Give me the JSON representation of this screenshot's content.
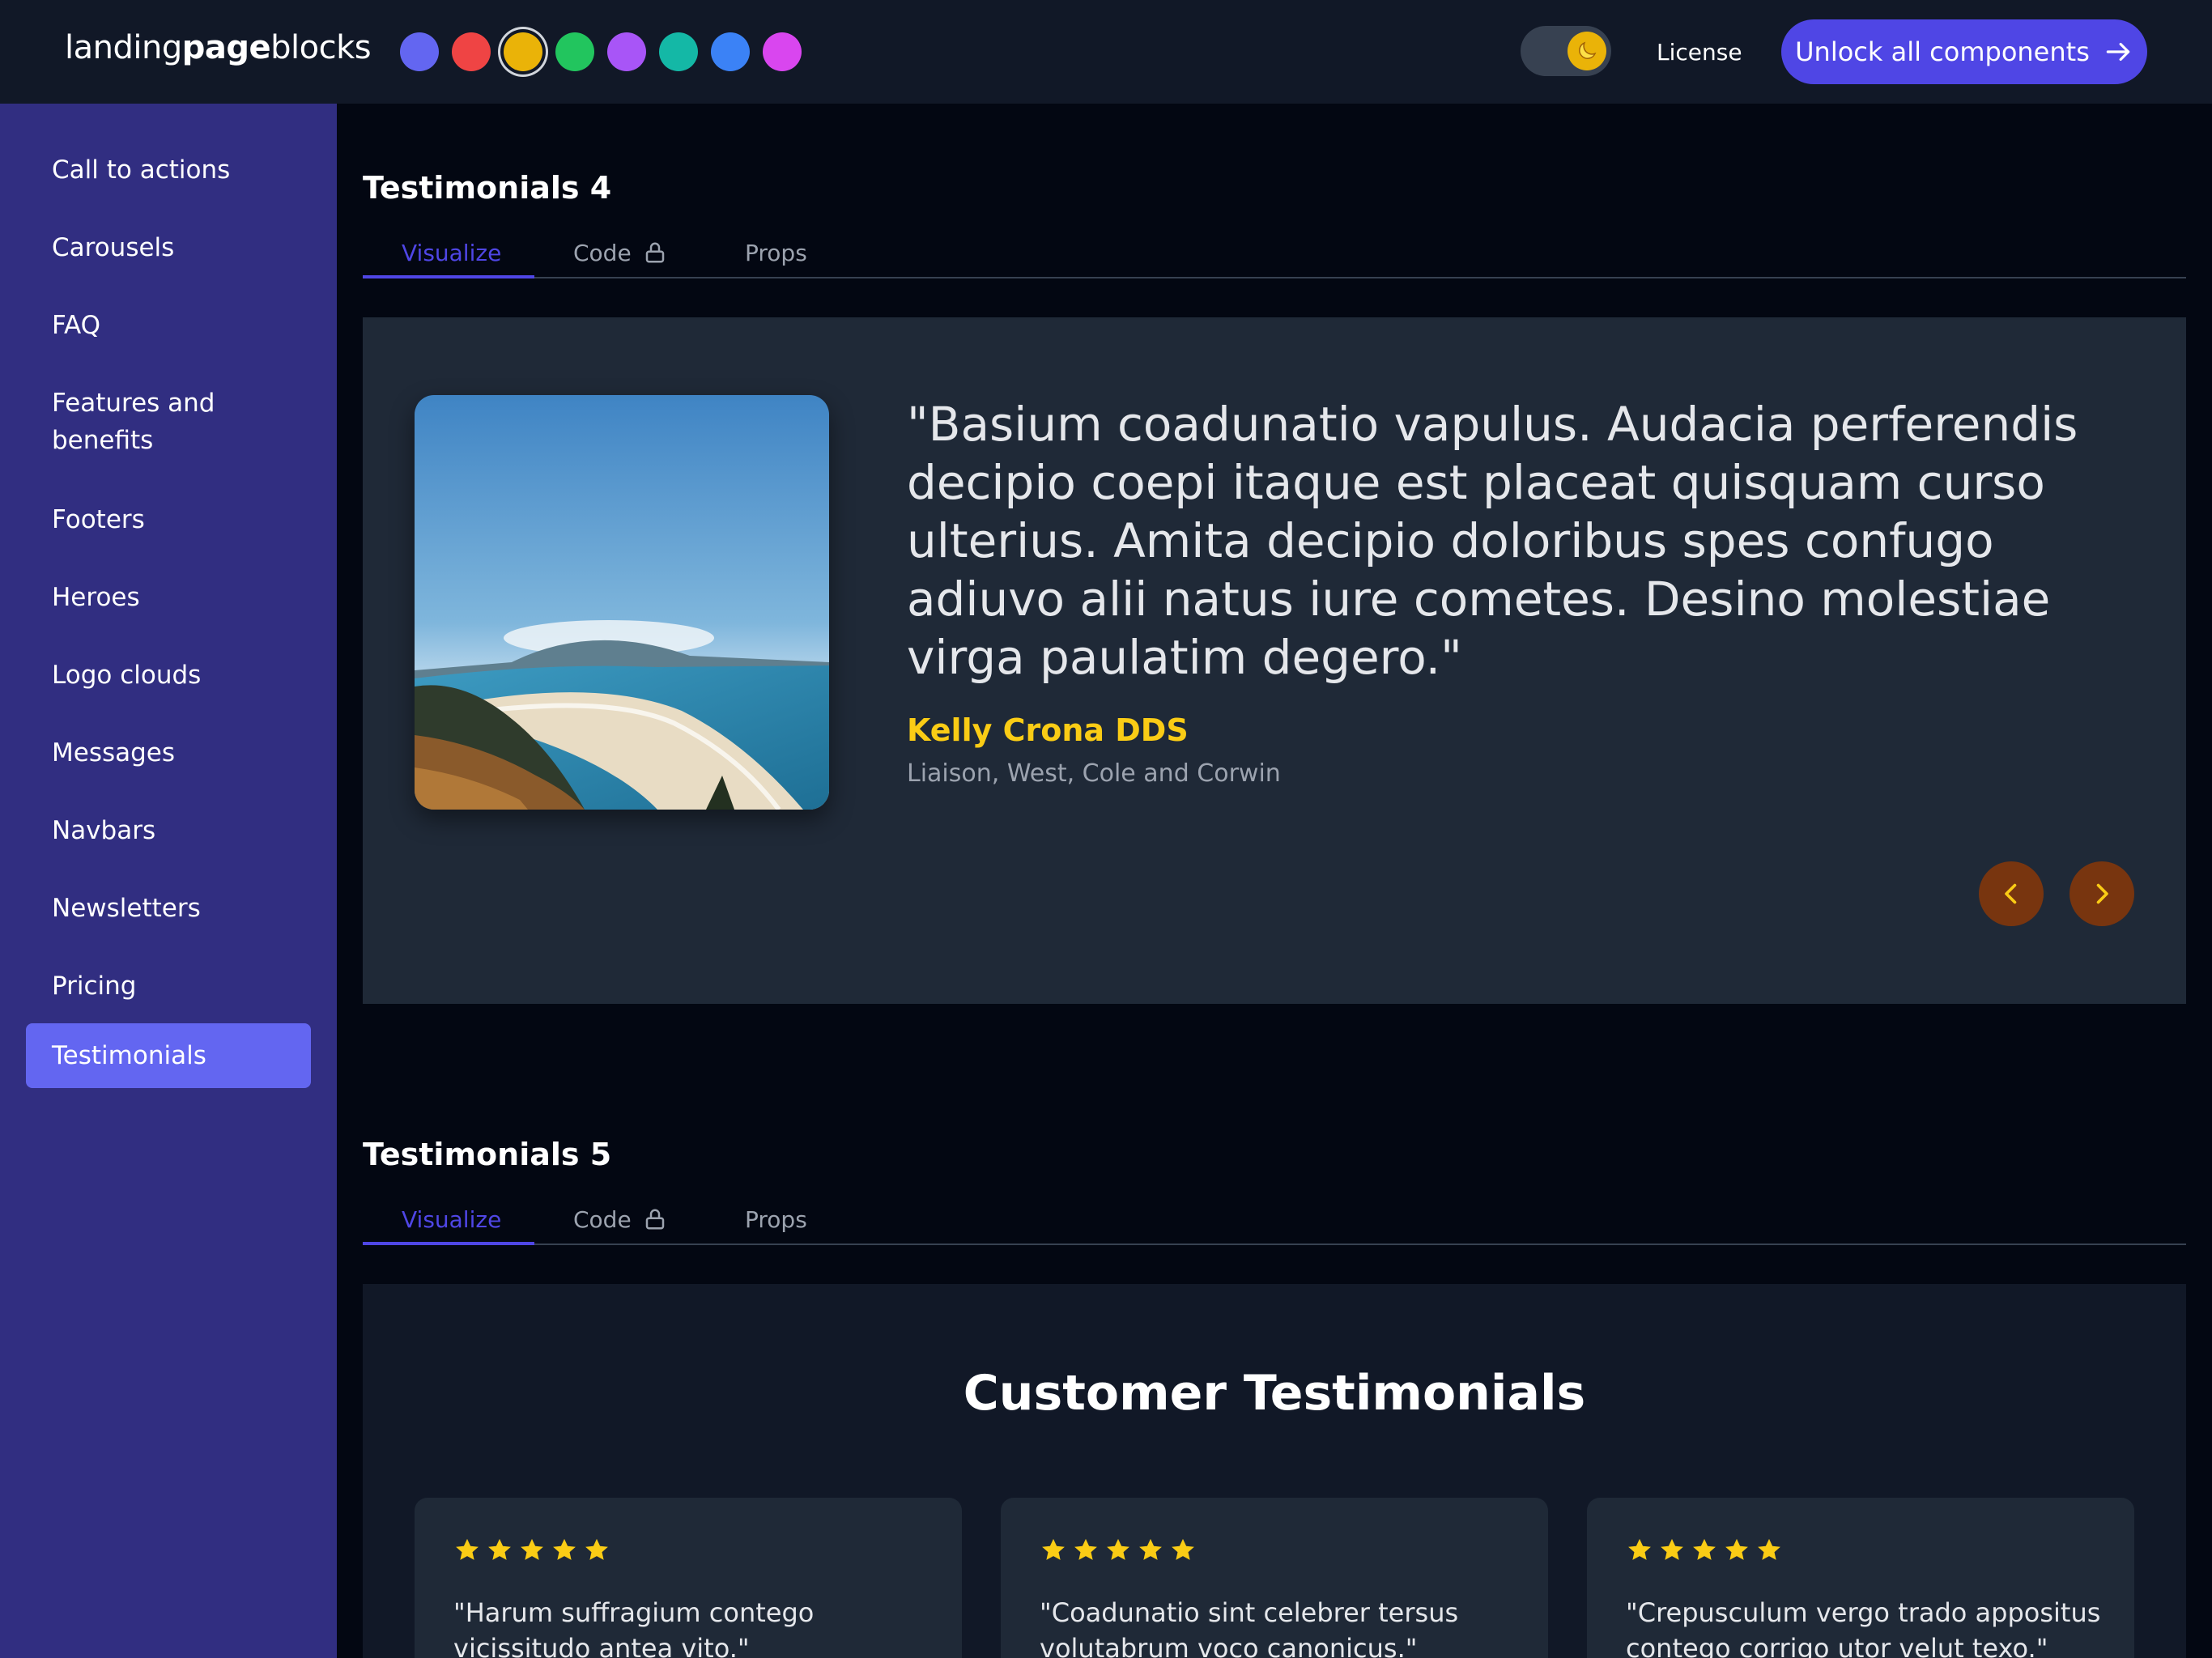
{
  "header": {
    "logo_part1": "landing",
    "logo_part2": "page",
    "logo_part3": "blocks",
    "swatches": [
      {
        "name": "indigo",
        "color": "#6366f1"
      },
      {
        "name": "red",
        "color": "#ef4444"
      },
      {
        "name": "yellow",
        "color": "#eab308",
        "selected": true
      },
      {
        "name": "green",
        "color": "#22c55e"
      },
      {
        "name": "purple",
        "color": "#a855f7"
      },
      {
        "name": "teal",
        "color": "#14b8a6"
      },
      {
        "name": "blue",
        "color": "#3b82f6"
      },
      {
        "name": "fuchsia",
        "color": "#d946ef"
      }
    ],
    "theme_toggle_icon": "moon-icon",
    "license_label": "License",
    "unlock_label": "Unlock all components"
  },
  "sidebar": {
    "items": [
      {
        "label": "Call to actions"
      },
      {
        "label": "Carousels"
      },
      {
        "label": "FAQ"
      },
      {
        "label": "Features and benefits"
      },
      {
        "label": "Footers"
      },
      {
        "label": "Heroes"
      },
      {
        "label": "Logo clouds"
      },
      {
        "label": "Messages"
      },
      {
        "label": "Navbars"
      },
      {
        "label": "Newsletters"
      },
      {
        "label": "Pricing"
      },
      {
        "label": "Testimonials",
        "active": true
      }
    ]
  },
  "sections": [
    {
      "title": "Testimonials 4",
      "tabs": [
        "Visualize",
        "Code",
        "Props"
      ]
    },
    {
      "title": "Testimonials 5",
      "tabs": [
        "Visualize",
        "Code",
        "Props"
      ]
    }
  ],
  "testimonial4": {
    "quote": "\"Basium coadunatio vapulus. Audacia perferendis decipio coepi itaque est placeat quisquam curso ulterius. Amita decipio doloribus spes confugo adiuvo alii natus iure cometes. Desino molestiae virga paulatim degero.\"",
    "author": "Kelly Crona DDS",
    "role": "Liaison, West, Cole and Corwin",
    "accent_color": "#facc15"
  },
  "testimonial5": {
    "heading": "Customer Testimonials",
    "cards": [
      {
        "rating": 5,
        "quote": "\"Harum suffragium contego vicissitudo antea vito.\""
      },
      {
        "rating": 5,
        "quote": "\"Coadunatio sint celebrer tersus volutabrum voco canonicus.\""
      },
      {
        "rating": 5,
        "quote": "\"Crepusculum vergo trado appositus contego corrigo utor velut texo.\""
      }
    ]
  }
}
